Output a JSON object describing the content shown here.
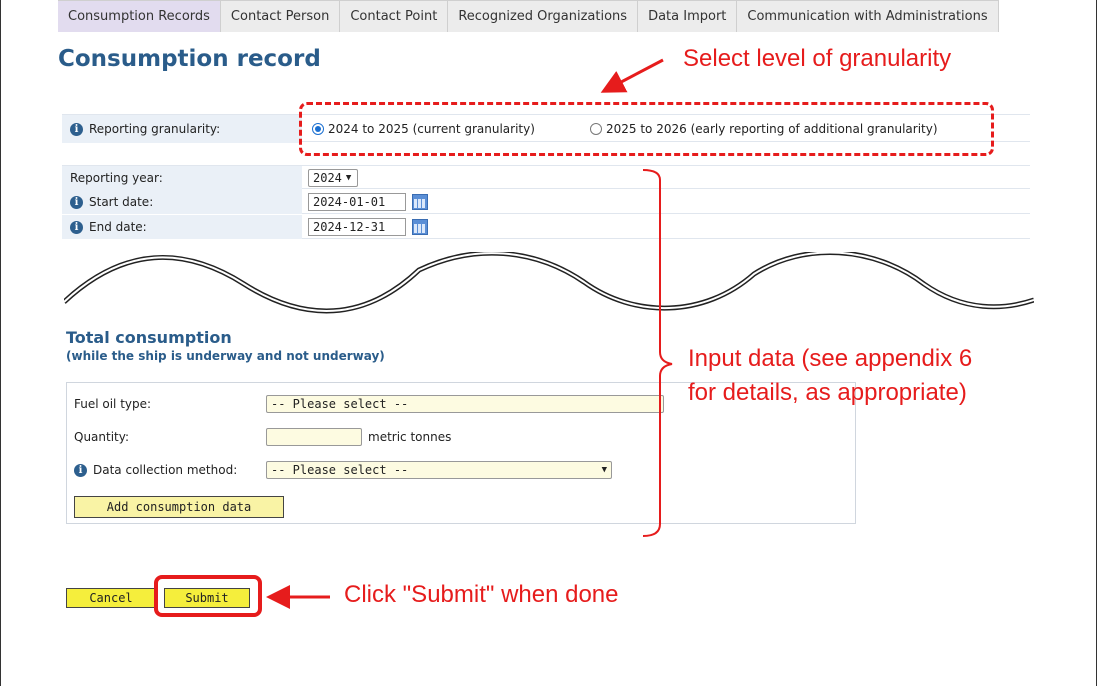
{
  "tabs": [
    {
      "label": "Consumption Records"
    },
    {
      "label": "Contact Person"
    },
    {
      "label": "Contact Point"
    },
    {
      "label": "Recognized Organizations"
    },
    {
      "label": "Data Import"
    },
    {
      "label": "Communication with Administrations"
    }
  ],
  "page": {
    "title": "Consumption record"
  },
  "granularity": {
    "label": "Reporting granularity:",
    "options": [
      {
        "label": "2024 to 2025 (current granularity)",
        "checked": true
      },
      {
        "label": "2025 to 2026 (early reporting of additional granularity)",
        "checked": false
      }
    ]
  },
  "period": {
    "year_label": "Reporting year:",
    "year_value": "2024",
    "start_label": "Start date:",
    "start_value": "2024-01-01",
    "end_label": "End date:",
    "end_value": "2024-12-31"
  },
  "total": {
    "title": "Total consumption",
    "subtitle": "(while the ship is underway and not underway)",
    "fuel_label": "Fuel oil type:",
    "fuel_value": "-- Please select --",
    "quantity_label": "Quantity:",
    "quantity_value": "",
    "quantity_unit": "metric tonnes",
    "method_label": "Data collection method:",
    "method_value": "-- Please select --",
    "add_button": "Add consumption data"
  },
  "actions": {
    "cancel": "Cancel",
    "submit": "Submit"
  },
  "annotations": {
    "granularity": "Select level of granularity",
    "input_line1": "Input data (see appendix 6",
    "input_line2": "for details, as appropriate)",
    "submit": "Click \"Submit\" when done"
  },
  "colors": {
    "annotation": "#e61c1c",
    "title": "#2a5c8a",
    "button": "#f5ee3c"
  }
}
